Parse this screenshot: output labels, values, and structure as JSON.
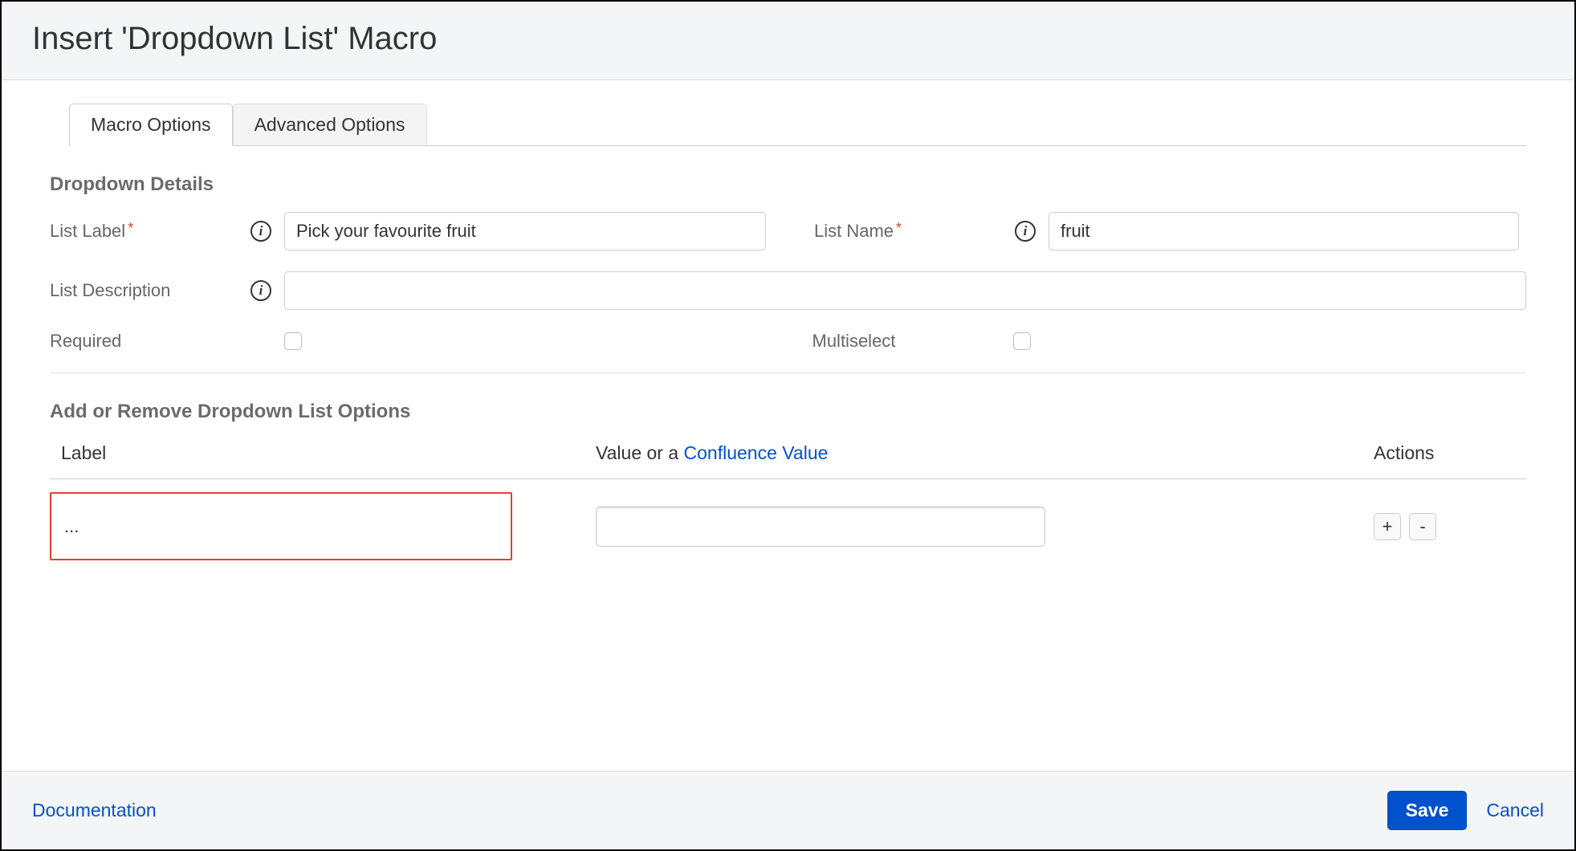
{
  "header": {
    "title": "Insert 'Dropdown List' Macro"
  },
  "tabs": {
    "macro_options": "Macro Options",
    "advanced_options": "Advanced Options"
  },
  "section1": {
    "title": "Dropdown Details",
    "list_label": {
      "label": "List Label",
      "value": "Pick your favourite fruit"
    },
    "list_name": {
      "label": "List Name",
      "value": "fruit"
    },
    "list_description": {
      "label": "List Description",
      "value": ""
    },
    "required": {
      "label": "Required",
      "checked": false
    },
    "multiselect": {
      "label": "Multiselect",
      "checked": false
    }
  },
  "section2": {
    "title": "Add or Remove Dropdown List Options",
    "columns": {
      "label": "Label",
      "value_prefix": "Value or a ",
      "value_link": "Confluence Value",
      "actions": "Actions"
    },
    "rows": [
      {
        "label": "...",
        "value": ""
      }
    ],
    "add_btn": "+",
    "remove_btn": "-"
  },
  "footer": {
    "documentation": "Documentation",
    "save": "Save",
    "cancel": "Cancel"
  }
}
